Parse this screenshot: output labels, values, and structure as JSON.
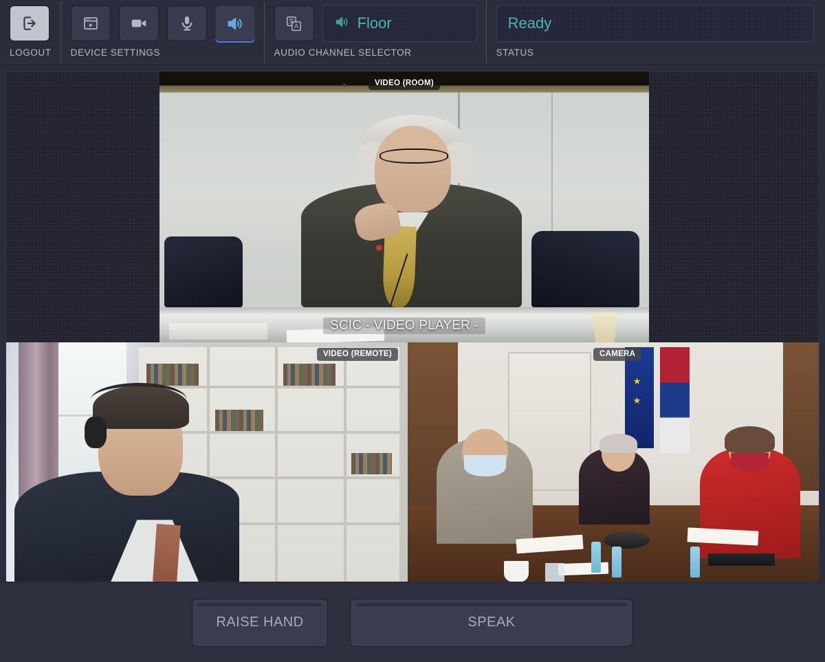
{
  "app": {
    "title": "SCIC Interactio Conference Client",
    "theme": {
      "background": "#2b2c3c",
      "panel": "#393a4e",
      "accent_blue": "#4d7fd6",
      "accent_teal": "#4db6ac",
      "text_muted": "#b9bac9"
    }
  },
  "toolbar": {
    "logout": {
      "label": "LOGOUT",
      "icon": "logout-icon",
      "state": "enabled"
    },
    "device_settings": {
      "label": "DEVICE SETTINGS",
      "buttons": [
        {
          "name": "video-player-window-icon",
          "icon": "media-window-icon",
          "active": false
        },
        {
          "name": "camera-icon",
          "icon": "video-camera-icon",
          "active": false
        },
        {
          "name": "microphone-icon",
          "icon": "microphone-icon",
          "active": false
        },
        {
          "name": "speaker-icon",
          "icon": "speaker-icon",
          "active": true
        }
      ]
    },
    "audio_channel_selector": {
      "label": "AUDIO CHANNEL SELECTOR",
      "translate_icon": "translate-icon",
      "channel_icon": "speaker-icon",
      "selected_channel": "Floor"
    },
    "status": {
      "label": "STATUS",
      "value": "Ready"
    }
  },
  "video": {
    "main": {
      "badge": "VIDEO (ROOM)",
      "caption": "SCIC - VIDEO PLAYER -"
    },
    "bottom_left": {
      "badge": "VIDEO (REMOTE)"
    },
    "bottom_right": {
      "badge": "CAMERA"
    }
  },
  "actions": {
    "raise_hand": "RAISE HAND",
    "speak": "SPEAK"
  }
}
